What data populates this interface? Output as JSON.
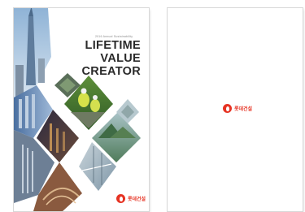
{
  "brand": {
    "accent_color": "#e63323"
  },
  "front_cover": {
    "kicker": "2016 Annual Sustainability",
    "title_lines": [
      "LIFETIME",
      "VALUE",
      "CREATOR"
    ],
    "logo_text": "롯데건설",
    "logo_icon": "lotte-emblem-icon"
  },
  "back_cover": {
    "logo_text": "롯데건설",
    "logo_icon": "lotte-emblem-icon"
  }
}
